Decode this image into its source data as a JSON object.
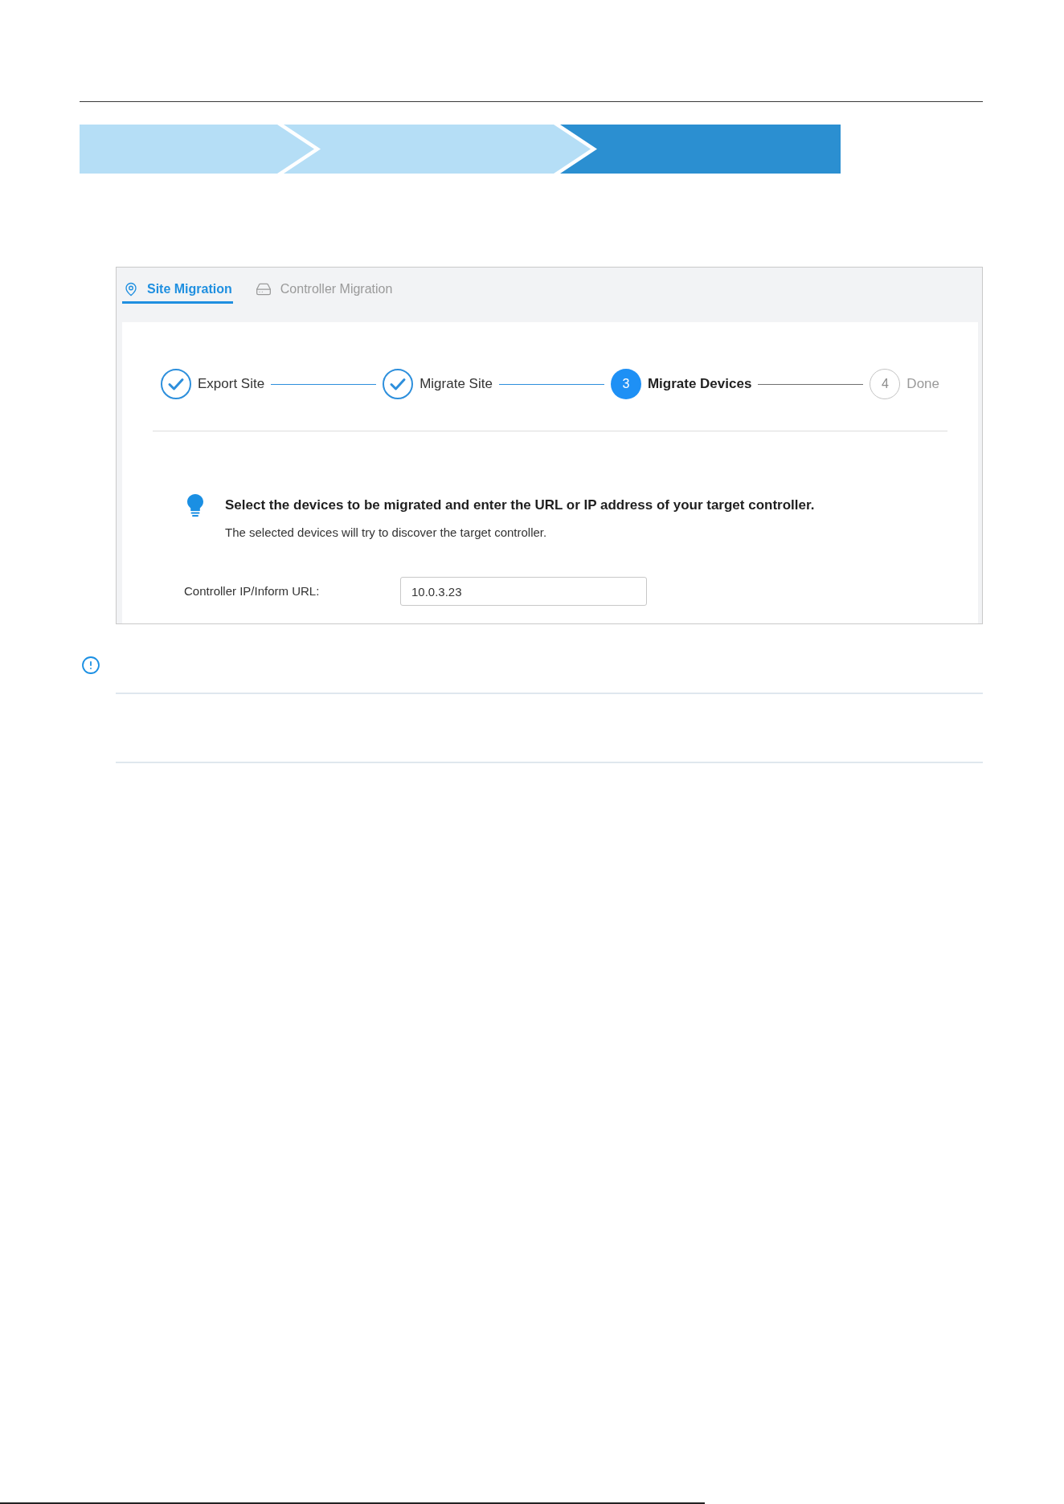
{
  "progress_banner": {
    "segments": [
      {
        "selected": false
      },
      {
        "selected": false
      },
      {
        "selected": true
      }
    ]
  },
  "tabs": [
    {
      "label": "Site Migration",
      "selected": true
    },
    {
      "label": "Controller Migration",
      "selected": false
    }
  ],
  "steps": [
    {
      "label": "Export Site",
      "done": true,
      "selected": false
    },
    {
      "label": "Migrate Site",
      "done": true,
      "selected": false
    },
    {
      "number": "3",
      "label": "Migrate Devices",
      "done": false,
      "selected": true
    },
    {
      "number": "4",
      "label": "Done",
      "done": false,
      "selected": false
    }
  ],
  "tip": {
    "title": "Select the devices to be migrated and enter the URL or IP address of your target controller.",
    "text": "The selected devices will try to discover the target controller."
  },
  "form": {
    "label": "Controller IP/Inform URL:",
    "value": "10.0.3.23"
  }
}
